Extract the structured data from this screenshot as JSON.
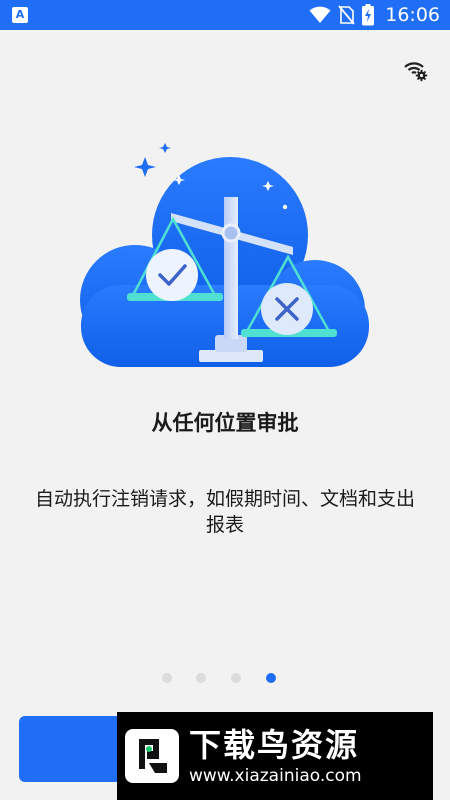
{
  "status_bar": {
    "time": "16:06",
    "app_icon_letter": "A",
    "icons": [
      "wifi-icon",
      "no-sim-icon",
      "battery-charging-icon"
    ]
  },
  "header": {
    "settings_icon": "network-settings-icon"
  },
  "onboarding": {
    "title": "从任何位置审批",
    "description": "自动执行注销请求，如假期时间、文档和支出报表",
    "page_count": 4,
    "active_page": 4
  },
  "primary_action": {
    "label": ""
  },
  "watermark": {
    "title": "下载鸟资源",
    "url": "www.xiazainiao.com"
  },
  "colors": {
    "brand": "#1f6ef5",
    "background": "#f2f2f2",
    "dot_inactive": "#dcdcdc"
  }
}
